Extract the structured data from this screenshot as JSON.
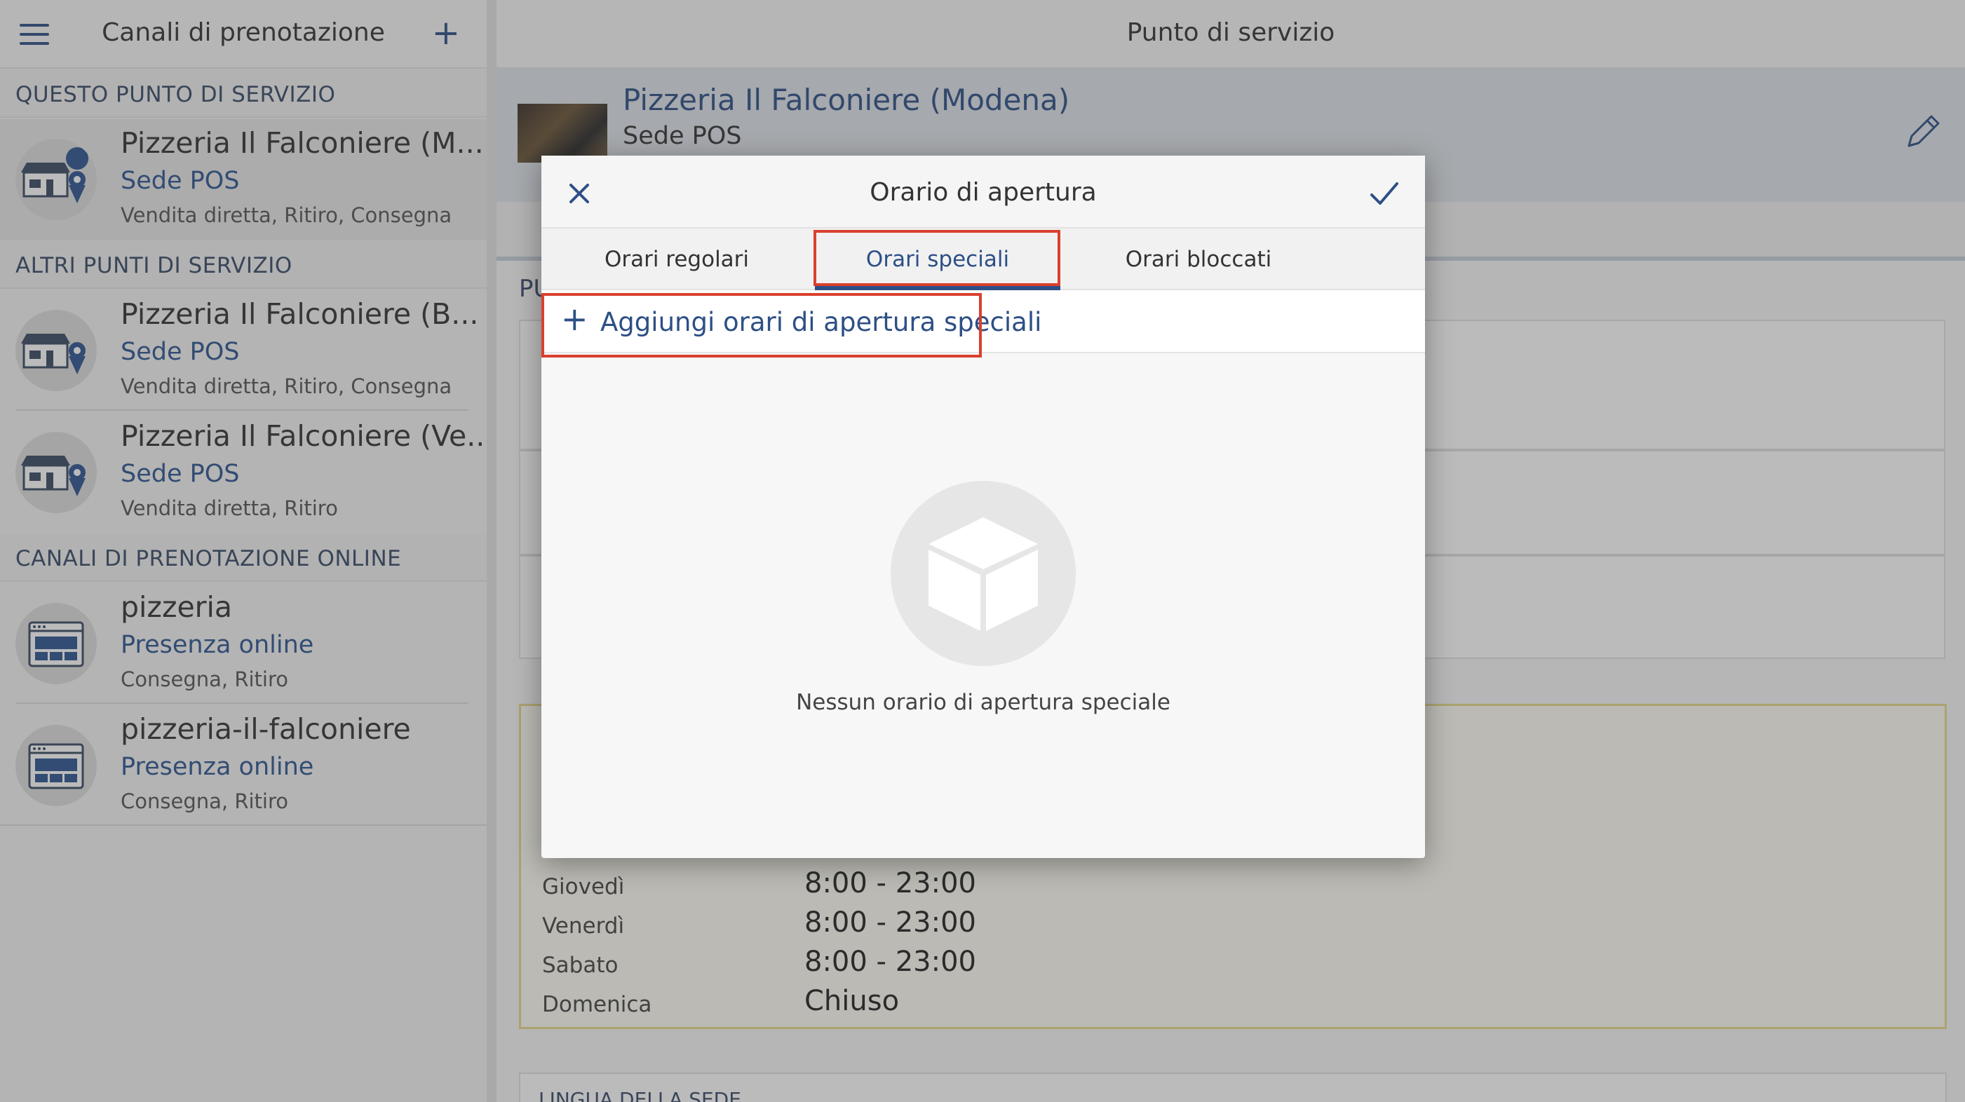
{
  "sidebar": {
    "title": "Canali di prenotazione",
    "add_label": "+",
    "sections": {
      "this_point": "QUESTO PUNTO DI SERVIZIO",
      "other_points": "ALTRI PUNTI DI SERVIZIO",
      "online": "CANALI DI PRENOTAZIONE ONLINE"
    },
    "items": [
      {
        "name": "Pizzeria Il Falconiere (M...",
        "kind": "Sede POS",
        "modes": "Vendita diretta, Ritiro, Consegna",
        "icon": "store-location-icon"
      },
      {
        "name": "Pizzeria Il Falconiere (B...",
        "kind": "Sede POS",
        "modes": "Vendita diretta, Ritiro, Consegna",
        "icon": "store-location-icon"
      },
      {
        "name": "Pizzeria Il Falconiere (Ve...",
        "kind": "Sede POS",
        "modes": "Vendita diretta, Ritiro",
        "icon": "store-location-icon"
      },
      {
        "name": "pizzeria",
        "kind": "Presenza online",
        "modes": "Consegna, Ritiro",
        "icon": "website-icon"
      },
      {
        "name": "pizzeria-il-falconiere",
        "kind": "Presenza online",
        "modes": "Consegna, Ritiro",
        "icon": "website-icon"
      }
    ]
  },
  "main": {
    "title": "Punto di servizio",
    "venue_name": "Pizzeria Il Falconiere (Modena)",
    "venue_subtitle": "Sede POS",
    "section_label_partial": "PU",
    "language_section": "LINGUA DELLA SEDE",
    "hours": [
      {
        "day": "Giovedì",
        "time": "8:00 - 23:00"
      },
      {
        "day": "Venerdì",
        "time": "8:00 - 23:00"
      },
      {
        "day": "Sabato",
        "time": "8:00 - 23:00"
      },
      {
        "day": "Domenica",
        "time": "Chiuso"
      }
    ]
  },
  "modal": {
    "title": "Orario di apertura",
    "tabs": [
      "Orari regolari",
      "Orari speciali",
      "Orari bloccati"
    ],
    "active_tab": "Orari speciali",
    "add_plus": "+",
    "add_label": "Aggiungi orari di apertura speciali",
    "empty_text": "Nessun orario di apertura speciale"
  },
  "colors": {
    "accent": "#2d4f86",
    "highlight": "#d9402d",
    "hours_border": "#e6d98a"
  }
}
